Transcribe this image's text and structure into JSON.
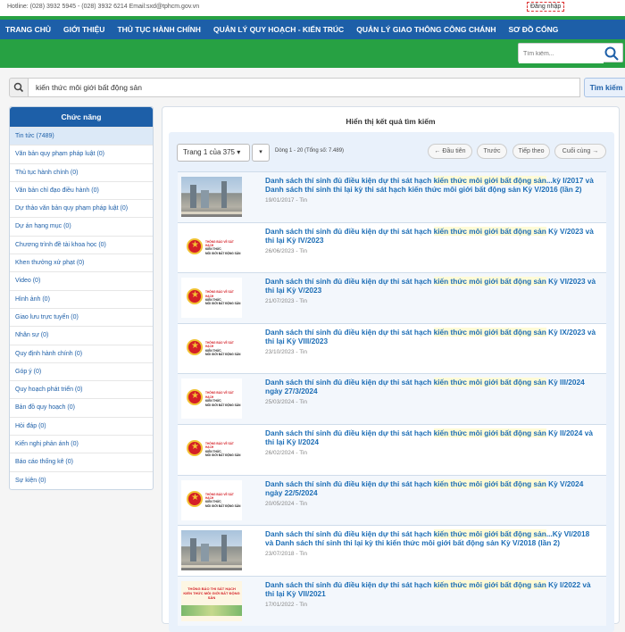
{
  "topbar": {
    "contacts": "Hotline: (028) 3932 5945 - (028) 3932 6214   Email:sxd@tphcm.gov.vn",
    "login": "Đăng nhập"
  },
  "nav": [
    "TRANG CHỦ",
    "GIỚI THIỆU",
    "THỦ TỤC HÀNH CHÍNH",
    "QUẢN LÝ QUY HOẠCH - KIẾN TRÚC",
    "QUẢN LÝ GIAO THÔNG CÔNG CHÁNH",
    "SƠ ĐỒ CỔNG"
  ],
  "header_search": {
    "placeholder": "Tìm kiếm..."
  },
  "search": {
    "query": "kiến thức môi giới bất động sản",
    "button": "Tìm kiếm"
  },
  "sidebar": {
    "title": "Chức năng",
    "items": [
      "Tin tức (7489)",
      "Văn bản quy phạm pháp luật (0)",
      "Thủ tục hành chính (0)",
      "Văn bản chỉ đạo điều hành (0)",
      "Dự thảo văn bản quy phạm pháp luật (0)",
      "Dự án hạng mục (0)",
      "Chương trình đề tài khoa học (0)",
      "Khen thưởng xử phạt (0)",
      "Video (0)",
      "Hình ảnh (0)",
      "Giao lưu trực tuyến (0)",
      "Nhân sự (0)",
      "Quy định hành chính (0)",
      "Góp ý (0)",
      "Quy hoạch phát triển (0)",
      "Bản đồ quy hoạch (0)",
      "Hỏi đáp (0)",
      "Kiến nghị phản ánh (0)",
      "Báo cáo thống kê (0)",
      "Sự kiện (0)"
    ]
  },
  "main": {
    "title": "Hiển thị kết quả tìm kiếm",
    "page_select": "Trang 1 của 375 ▾",
    "caret": "▾",
    "count": "Dòng 1 - 20 (Tổng số: 7.489)",
    "buttons": {
      "first": "← Đầu tiên",
      "prev": "Trước",
      "next": "Tiếp theo",
      "last": "Cuối cùng →"
    },
    "thumb_text": {
      "line1": "THÔNG BÁO VỀ SÁT HẠCH",
      "line2": "KIẾN THỨC",
      "line3": "MÔI GIỚI BẤT ĐỘNG SẢN"
    },
    "poster_text": {
      "line1": "THÔNG BÁO THI SÁT HẠCH",
      "line2": "KIẾN THỨC MÔI GIỚI BẤT ĐỘNG SẢN"
    }
  },
  "results": [
    {
      "thumb": "city",
      "pre": "Danh sách thí sinh đủ điều kiện dự thi sát hạch ",
      "hl": "kiến thức môi giới bất động sản",
      "post": "...kỳ I/2017 và Danh sách thí sinh thi lại kỳ thi sát hạch kiến thức môi giới bất động sản Kỳ V/2016 (lần 2)",
      "date": "19/01/2017 - Tin"
    },
    {
      "thumb": "notice",
      "pre": "Danh sách thí sinh đủ điều kiện dự thi sát hạch ",
      "hl": "kiến thức môi giới bất động sản",
      "post": " Kỳ V/2023 và thi lại Kỳ IV/2023",
      "date": "26/06/2023 - Tin"
    },
    {
      "thumb": "notice",
      "pre": "Danh sách thí sinh đủ điều kiện dự thi sát hạch ",
      "hl": "kiến thức môi giới bất động sản",
      "post": " Kỳ VI/2023 và thi lại Kỳ V/2023",
      "date": "21/07/2023 - Tin"
    },
    {
      "thumb": "notice",
      "pre": "Danh sách thí sinh đủ điều kiện dự thi sát hạch ",
      "hl": "kiến thức môi giới bất động sản",
      "post": " Kỳ IX/2023 và thi lại Kỳ VIII/2023",
      "date": "23/10/2023 - Tin"
    },
    {
      "thumb": "notice",
      "pre": "Danh sách thí sinh đủ điều kiện dự thi sát hạch ",
      "hl": "kiến thức môi giới bất động sản",
      "post": " Kỳ III/2024 ngày 27/3/2024",
      "date": "25/03/2024 - Tin"
    },
    {
      "thumb": "notice",
      "pre": "Danh sách thí sinh đủ điều kiện dự thi sát hạch ",
      "hl": "kiến thức môi giới bất động sản",
      "post": " Kỳ II/2024 và thi lại Kỳ I/2024",
      "date": "26/02/2024 - Tin"
    },
    {
      "thumb": "notice",
      "pre": "Danh sách thí sinh đủ điều kiện dự thi sát hạch ",
      "hl": "kiến thức môi giới bất động sản",
      "post": " Kỳ V/2024 ngày 22/5/2024",
      "date": "20/05/2024 - Tin"
    },
    {
      "thumb": "city",
      "pre": "Danh sách thí sinh đủ điều kiện dự thi sát hạch ",
      "hl": "kiến thức môi giới bất động sản",
      "post": "...Kỳ VI/2018 và Danh sách thí sinh thi lại kỳ thi kiến thức môi giới bất động sản Kỳ V/2018 (lần 2)",
      "date": "23/07/2018 - Tin"
    },
    {
      "thumb": "poster",
      "pre": "Danh sách thí sinh đủ điều kiện dự thi sát hạch ",
      "hl": "kiến thức môi giới bất động sản",
      "post": " Kỳ I/2022 và thi lại Kỳ VII/2021",
      "date": "17/01/2022 - Tin"
    }
  ],
  "colors": {
    "nav_blue": "#1d5fa8",
    "brand_green": "#27a143",
    "link_blue": "#1d6eb6"
  }
}
